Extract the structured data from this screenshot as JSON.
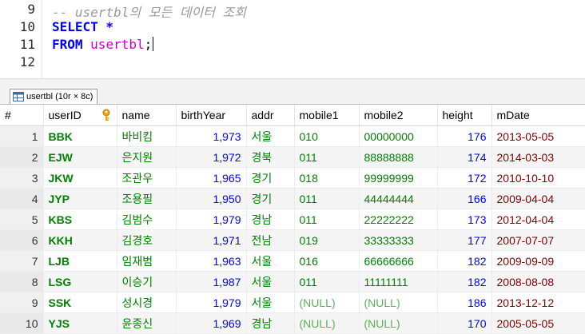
{
  "editor": {
    "lines": [
      {
        "num": "9",
        "comment": "-- usertbl의 모든 데이터 조회"
      },
      {
        "num": "10",
        "kw": "SELECT",
        "rest": " *"
      },
      {
        "num": "11",
        "kw": "FROM",
        "ident": "usertbl",
        "semi": ";"
      },
      {
        "num": "12"
      }
    ]
  },
  "result_tab": {
    "label": "usertbl (10r × 8c)"
  },
  "grid": {
    "columns": [
      "#",
      "userID",
      "name",
      "birthYear",
      "addr",
      "mobile1",
      "mobile2",
      "height",
      "mDate"
    ],
    "primary_key_column": "userID",
    "rows": [
      {
        "n": "1",
        "userID": "BBK",
        "name": "바비킴",
        "birthYear": "1,973",
        "addr": "서울",
        "mobile1": "010",
        "mobile2": "00000000",
        "height": "176",
        "mDate": "2013-05-05"
      },
      {
        "n": "2",
        "userID": "EJW",
        "name": "은지원",
        "birthYear": "1,972",
        "addr": "경북",
        "mobile1": "011",
        "mobile2": "88888888",
        "height": "174",
        "mDate": "2014-03-03"
      },
      {
        "n": "3",
        "userID": "JKW",
        "name": "조관우",
        "birthYear": "1,965",
        "addr": "경기",
        "mobile1": "018",
        "mobile2": "99999999",
        "height": "172",
        "mDate": "2010-10-10"
      },
      {
        "n": "4",
        "userID": "JYP",
        "name": "조용필",
        "birthYear": "1,950",
        "addr": "경기",
        "mobile1": "011",
        "mobile2": "44444444",
        "height": "166",
        "mDate": "2009-04-04"
      },
      {
        "n": "5",
        "userID": "KBS",
        "name": "김범수",
        "birthYear": "1,979",
        "addr": "경남",
        "mobile1": "011",
        "mobile2": "22222222",
        "height": "173",
        "mDate": "2012-04-04"
      },
      {
        "n": "6",
        "userID": "KKH",
        "name": "김경호",
        "birthYear": "1,971",
        "addr": "전남",
        "mobile1": "019",
        "mobile2": "33333333",
        "height": "177",
        "mDate": "2007-07-07"
      },
      {
        "n": "7",
        "userID": "LJB",
        "name": "임재범",
        "birthYear": "1,963",
        "addr": "서울",
        "mobile1": "016",
        "mobile2": "66666666",
        "height": "182",
        "mDate": "2009-09-09"
      },
      {
        "n": "8",
        "userID": "LSG",
        "name": "이승기",
        "birthYear": "1,987",
        "addr": "서울",
        "mobile1": "011",
        "mobile2": "11111111",
        "height": "182",
        "mDate": "2008-08-08"
      },
      {
        "n": "9",
        "userID": "SSK",
        "name": "성시경",
        "birthYear": "1,979",
        "addr": "서울",
        "mobile1": "(NULL)",
        "mobile2": "(NULL)",
        "height": "186",
        "mDate": "2013-12-12"
      },
      {
        "n": "10",
        "userID": "YJS",
        "name": "윤종신",
        "birthYear": "1,969",
        "addr": "경남",
        "mobile1": "(NULL)",
        "mobile2": "(NULL)",
        "height": "170",
        "mDate": "2005-05-05"
      }
    ]
  },
  "icons": {
    "tab": "table-icon",
    "pk": "key-icon"
  },
  "colors": {
    "keyword": "#0000ff",
    "identifier": "#cc00cc",
    "comment": "#9a9a9a",
    "text_value": "#008000",
    "number_value": "#0000ff",
    "date_value": "#800000"
  }
}
